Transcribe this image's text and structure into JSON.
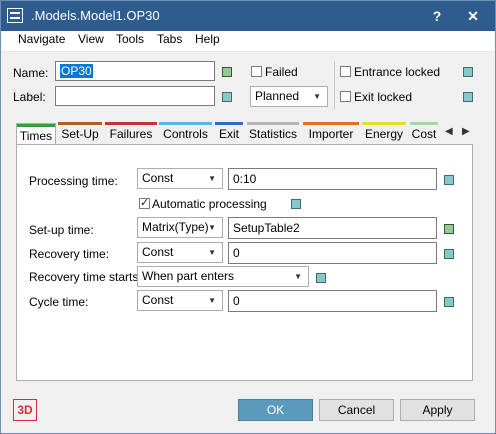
{
  "window": {
    "title": ".Models.Model1.OP30",
    "help_glyph": "?",
    "close_glyph": "✕"
  },
  "menu": [
    "Navigate",
    "View",
    "Tools",
    "Tabs",
    "Help"
  ],
  "header": {
    "name_label": "Name:",
    "name_value": "OP30",
    "label_label": "Label:",
    "label_value": "",
    "failed_label": "Failed",
    "failed_checked": false,
    "planned_value": "Planned",
    "entrance_locked_label": "Entrance locked",
    "entrance_locked_checked": false,
    "exit_locked_label": "Exit locked",
    "exit_locked_checked": false
  },
  "tabs": [
    {
      "label": "Times",
      "color": "#3c9b3c",
      "active": true
    },
    {
      "label": "Set-Up",
      "color": "#a06428"
    },
    {
      "label": "Failures",
      "color": "#c83232"
    },
    {
      "label": "Controls",
      "color": "#5ab4e6"
    },
    {
      "label": "Exit",
      "color": "#3c64c8"
    },
    {
      "label": "Statistics",
      "color": "#b4b4b4"
    },
    {
      "label": "Importer",
      "color": "#e66e1e"
    },
    {
      "label": "Energy",
      "color": "#e6dc32"
    },
    {
      "label": "Cost",
      "color": "#a0dca0"
    }
  ],
  "times": {
    "processing_label": "Processing time:",
    "processing_type": "Const",
    "processing_value": "0:10",
    "auto_processing_label": "Automatic processing",
    "auto_processing_checked": true,
    "setup_label": "Set-up time:",
    "setup_type": "Matrix(Type)",
    "setup_value": "SetupTable2",
    "recovery_label": "Recovery time:",
    "recovery_type": "Const",
    "recovery_value": "0",
    "recovery_starts_label": "Recovery time starts:",
    "recovery_starts_value": "When part enters",
    "cycle_label": "Cycle time:",
    "cycle_type": "Const",
    "cycle_value": "0"
  },
  "footer": {
    "logo": "3D",
    "ok": "OK",
    "cancel": "Cancel",
    "apply": "Apply"
  }
}
